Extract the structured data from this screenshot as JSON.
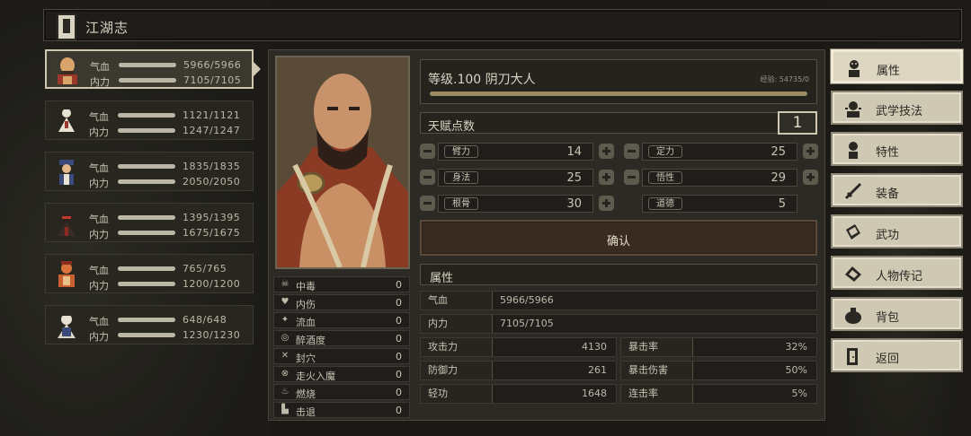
{
  "window": {
    "title": "江湖志"
  },
  "party": [
    {
      "hp_label": "气血",
      "hp": "5966/5966",
      "mp_label": "内力",
      "mp": "7105/7105"
    },
    {
      "hp_label": "气血",
      "hp": "1121/1121",
      "mp_label": "内力",
      "mp": "1247/1247"
    },
    {
      "hp_label": "气血",
      "hp": "1835/1835",
      "mp_label": "内力",
      "mp": "2050/2050"
    },
    {
      "hp_label": "气血",
      "hp": "1395/1395",
      "mp_label": "内力",
      "mp": "1675/1675"
    },
    {
      "hp_label": "气血",
      "hp": "765/765",
      "mp_label": "内力",
      "mp": "1200/1200"
    },
    {
      "hp_label": "气血",
      "hp": "648/648",
      "mp_label": "内力",
      "mp": "1230/1230"
    }
  ],
  "character": {
    "level_title": "等级.100 阴刀大人",
    "exp": "经验: 54735/0",
    "talent_label": "天赋点数",
    "talent_points": "1"
  },
  "alloc": [
    {
      "name": "臂力",
      "value": "14"
    },
    {
      "name": "定力",
      "value": "25"
    },
    {
      "name": "身法",
      "value": "25"
    },
    {
      "name": "悟性",
      "value": "29"
    },
    {
      "name": "根骨",
      "value": "30"
    },
    {
      "name": "道德",
      "value": "5"
    }
  ],
  "confirm_label": "确认",
  "attr_section": "属性",
  "stats": {
    "hp_label": "气血",
    "hp": "5966/5966",
    "mp_label": "内力",
    "mp": "7105/7105",
    "atk_label": "攻击力",
    "atk": "4130",
    "crit_label": "暴击率",
    "crit": "32%",
    "def_label": "防御力",
    "def": "261",
    "critdmg_label": "暴击伤害",
    "critdmg": "50%",
    "agi_label": "轻功",
    "agi": "1648",
    "combo_label": "连击率",
    "combo": "5%"
  },
  "status_effects": [
    {
      "icon": "skull-icon",
      "name": "中毒",
      "count": "0"
    },
    {
      "icon": "broken-heart-icon",
      "name": "内伤",
      "count": "0"
    },
    {
      "icon": "blood-drop-icon",
      "name": "流血",
      "count": "0"
    },
    {
      "icon": "swirl-icon",
      "name": "醉酒度",
      "count": "0"
    },
    {
      "icon": "seal-icon",
      "name": "封穴",
      "count": "0"
    },
    {
      "icon": "demon-icon",
      "name": "走火入魔",
      "count": "0"
    },
    {
      "icon": "flame-icon",
      "name": "燃烧",
      "count": "0"
    },
    {
      "icon": "knockback-icon",
      "name": "击退",
      "count": "0"
    }
  ],
  "menu": [
    {
      "icon": "attributes-icon",
      "label": "属性"
    },
    {
      "icon": "martial-skills-icon",
      "label": "武学技法"
    },
    {
      "icon": "traits-icon",
      "label": "特性"
    },
    {
      "icon": "equipment-icon",
      "label": "装备"
    },
    {
      "icon": "martial-arts-book-icon",
      "label": "武功"
    },
    {
      "icon": "biography-icon",
      "label": "人物传记"
    },
    {
      "icon": "backpack-icon",
      "label": "背包"
    },
    {
      "icon": "return-door-icon",
      "label": "返回"
    }
  ],
  "colors": {
    "panel": "#2b2a24",
    "menu_bg": "#cfc8b3",
    "confirm_bg": "#3a2b20",
    "exp_bar": "#9b8c66"
  }
}
